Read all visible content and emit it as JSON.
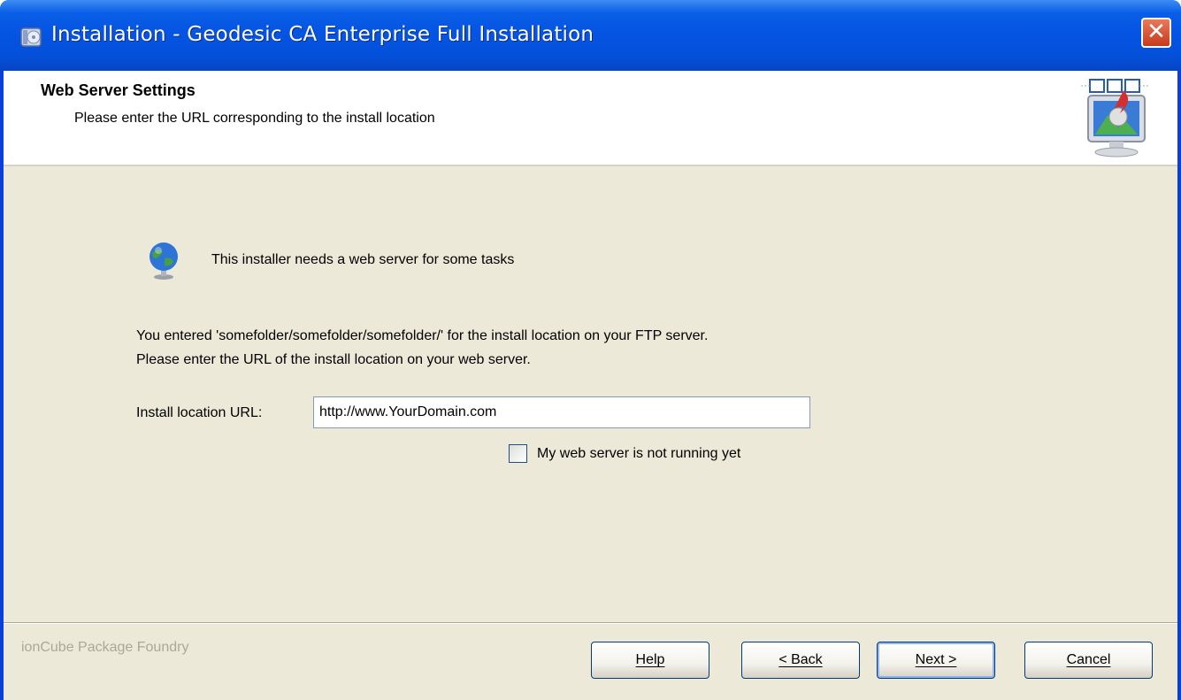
{
  "window": {
    "title": "Installation - Geodesic CA Enterprise Full Installation",
    "close_symbol": "✕"
  },
  "header": {
    "title": "Web Server Settings",
    "subtitle": "Please enter the URL corresponding to the install location"
  },
  "body": {
    "info_text": "This installer needs a web server for some tasks",
    "paragraph_line1": "You entered 'somefolder/somefolder/somefolder/' for the install location on your FTP server.",
    "paragraph_line2": "Please enter the URL of the install location on your web server.",
    "url_label": "Install location URL:",
    "url_value": "http://www.YourDomain.com",
    "checkbox_label": "My web server is not running yet",
    "checkbox_checked": false
  },
  "footer": {
    "brand": "ionCube Package Foundry",
    "buttons": {
      "help": "Help",
      "back": "< Back",
      "next": "Next >",
      "cancel": "Cancel"
    }
  },
  "icons": {
    "title_icon": "installer-cd-icon",
    "header_icon": "install-computer-icon",
    "info_icon": "globe-icon"
  },
  "colors": {
    "titlebar": "#0554e3",
    "client_bg": "#ece9d8",
    "close_button": "#c73a1b"
  }
}
